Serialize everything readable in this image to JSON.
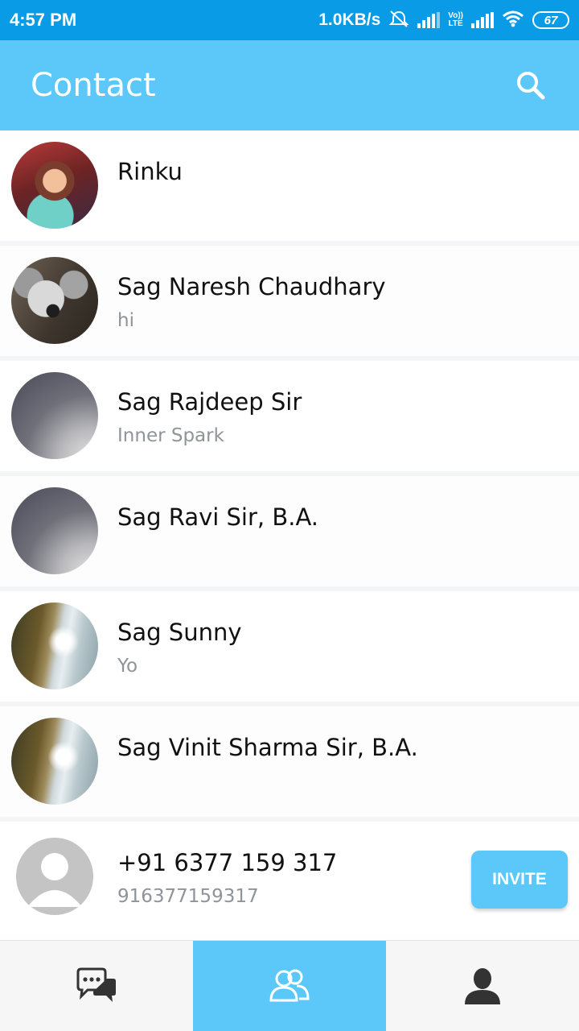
{
  "status_bar": {
    "time": "4:57 PM",
    "speed": "1.0KB/s",
    "lte_top": "Vo))",
    "lte_bottom": "LTE",
    "battery": "67"
  },
  "app_bar": {
    "title": "Contact",
    "search_icon": "search-icon"
  },
  "contacts": [
    {
      "name": "Rinku",
      "status": "",
      "avatar": "photo-child"
    },
    {
      "name": "Sag Naresh Chaudhary",
      "status": "hi",
      "avatar": "photo-koala"
    },
    {
      "name": "Sag Rajdeep Sir",
      "status": "Inner Spark",
      "avatar": "photo-gray"
    },
    {
      "name": "Sag Ravi Sir, B.A.",
      "status": "",
      "avatar": "photo-gray"
    },
    {
      "name": "Sag Sunny",
      "status": "Yo",
      "avatar": "photo-waterfall"
    },
    {
      "name": "Sag Vinit Sharma Sir, B.A.",
      "status": "",
      "avatar": "photo-waterfall"
    },
    {
      "name": "+91 6377 159 317",
      "status": "916377159317",
      "avatar": "default-avatar",
      "action": "INVITE"
    }
  ],
  "bottom_nav": {
    "items": [
      {
        "icon": "chat-icon",
        "active": false
      },
      {
        "icon": "contacts-icon",
        "active": true
      },
      {
        "icon": "profile-icon",
        "active": false
      }
    ]
  },
  "colors": {
    "status_bar": "#0a9be6",
    "accent": "#5cc8fa",
    "text_primary": "#111111",
    "text_secondary": "#8f9498"
  }
}
